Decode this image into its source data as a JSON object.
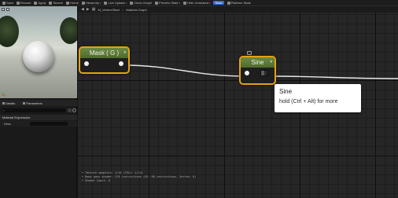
{
  "toolbar": {
    "items": [
      "Save",
      "Browse",
      "Apply",
      "Search",
      "Home",
      "Hierarchy",
      "Live Update",
      "Clean Graph",
      "Preview State",
      "Hide Unrelated"
    ],
    "live_label": "Stats",
    "platform_label": "Platform Stats"
  },
  "viewport": {
    "accent_color": "#e5a20f"
  },
  "left_panel": {
    "tabs": [
      "Details",
      "Parameters"
    ],
    "section_title": "Material Expression",
    "property_label": "Desc"
  },
  "graph": {
    "breadcrumb": [
      "M_VertexOffset",
      "Material Graph"
    ],
    "nodes": [
      {
        "title": "Mask ( G )",
        "color": "#5b7a36"
      },
      {
        "title": "Sine",
        "color": "#5b7a36"
      }
    ],
    "tooltip": {
      "title": "Sine",
      "hint": "hold (Ctrl + Alt) for more"
    },
    "log_lines": [
      "• Texture samplers: 1/16 (TEX1: 1/13)",
      "• Base pass shader: 278 instructions (VS: 88 instructions, Vertex: 8)",
      "• Shader Count: 8"
    ]
  }
}
